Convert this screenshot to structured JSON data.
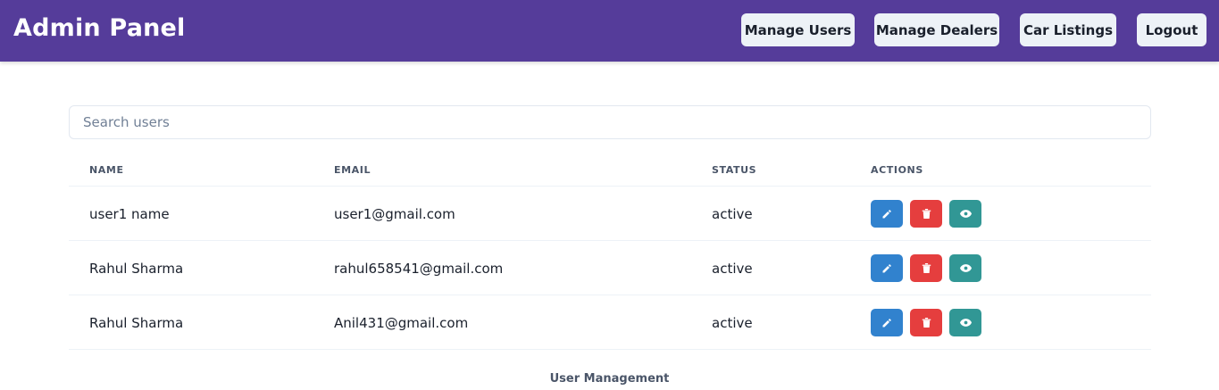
{
  "header": {
    "title": "Admin Panel",
    "nav": {
      "manage_users": "Manage Users",
      "manage_dealers": "Manage Dealers",
      "car_listings": "Car Listings",
      "logout": "Logout"
    }
  },
  "search": {
    "placeholder": "Search users",
    "value": ""
  },
  "table": {
    "headers": [
      "Name",
      "Email",
      "Status",
      "Actions"
    ],
    "rows": [
      {
        "name": "user1 name",
        "email": "user1@gmail.com",
        "status": "active",
        "actions": [
          "edit-icon",
          "trash-icon",
          "eye-icon"
        ]
      },
      {
        "name": "Rahul Sharma",
        "email": "rahul658541@gmail.com",
        "status": "active",
        "actions": [
          "edit-icon",
          "trash-icon",
          "eye-icon"
        ]
      },
      {
        "name": "Rahul Sharma",
        "email": "Anil431@gmail.com",
        "status": "active",
        "actions": [
          "edit-icon",
          "trash-icon",
          "eye-icon"
        ]
      }
    ]
  },
  "footer": {
    "text": "User Management"
  },
  "colors": {
    "header_bg": "#553c9a",
    "edit": "#3182ce",
    "delete": "#e53e3e",
    "view": "#319795"
  }
}
